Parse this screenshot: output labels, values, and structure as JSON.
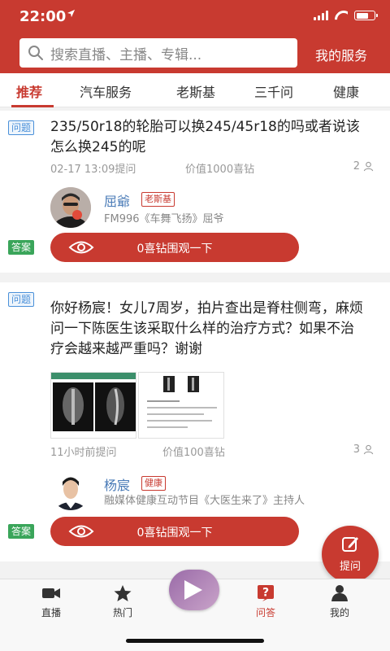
{
  "status_bar": {
    "time": "22:00",
    "location_icon": "location-arrow-icon"
  },
  "header": {
    "search_placeholder": "搜索直播、主播、专辑...",
    "my_service": "我的服务",
    "color": "#c83a30"
  },
  "tabs": [
    {
      "label": "推荐",
      "active": true
    },
    {
      "label": "汽车服务",
      "active": false
    },
    {
      "label": "老斯基",
      "active": false
    },
    {
      "label": "三千问",
      "active": false
    },
    {
      "label": "健康",
      "active": false
    }
  ],
  "questions": [
    {
      "q_tag": "问题",
      "text": "235/50r18的轮胎可以换245/45r18的吗或者说该怎么换245的呢",
      "time": "02-17 13:09提问",
      "value": "价值1000喜钻",
      "count": "2",
      "answerer": {
        "name": "屈爺",
        "badge": "老斯基",
        "desc": "FM996《车舞飞扬》屈爷"
      },
      "a_tag": "答案",
      "button": "0喜钻围观一下"
    },
    {
      "q_tag": "问题",
      "text": "你好杨宸！女儿7周岁，拍片查出是脊柱侧弯，麻烦问一下陈医生该采取什么样的治疗方式？如果不治疗会越来越严重吗？谢谢",
      "time": "11小时前提问",
      "value": "价值100喜钻",
      "count": "3",
      "answerer": {
        "name": "杨宸",
        "badge": "健康",
        "desc": "融媒体健康互动节目《大医生来了》主持人"
      },
      "a_tag": "答案",
      "button": "0喜钻围观一下"
    }
  ],
  "fab": {
    "label": "提问",
    "icon": "edit-icon"
  },
  "bottom_nav": [
    {
      "label": "直播",
      "icon": "video-camera-icon",
      "active": false
    },
    {
      "label": "热门",
      "icon": "star-icon",
      "active": false
    },
    {
      "label": "问答",
      "icon": "question-icon",
      "active": true
    },
    {
      "label": "我的",
      "icon": "user-icon",
      "active": false
    }
  ]
}
